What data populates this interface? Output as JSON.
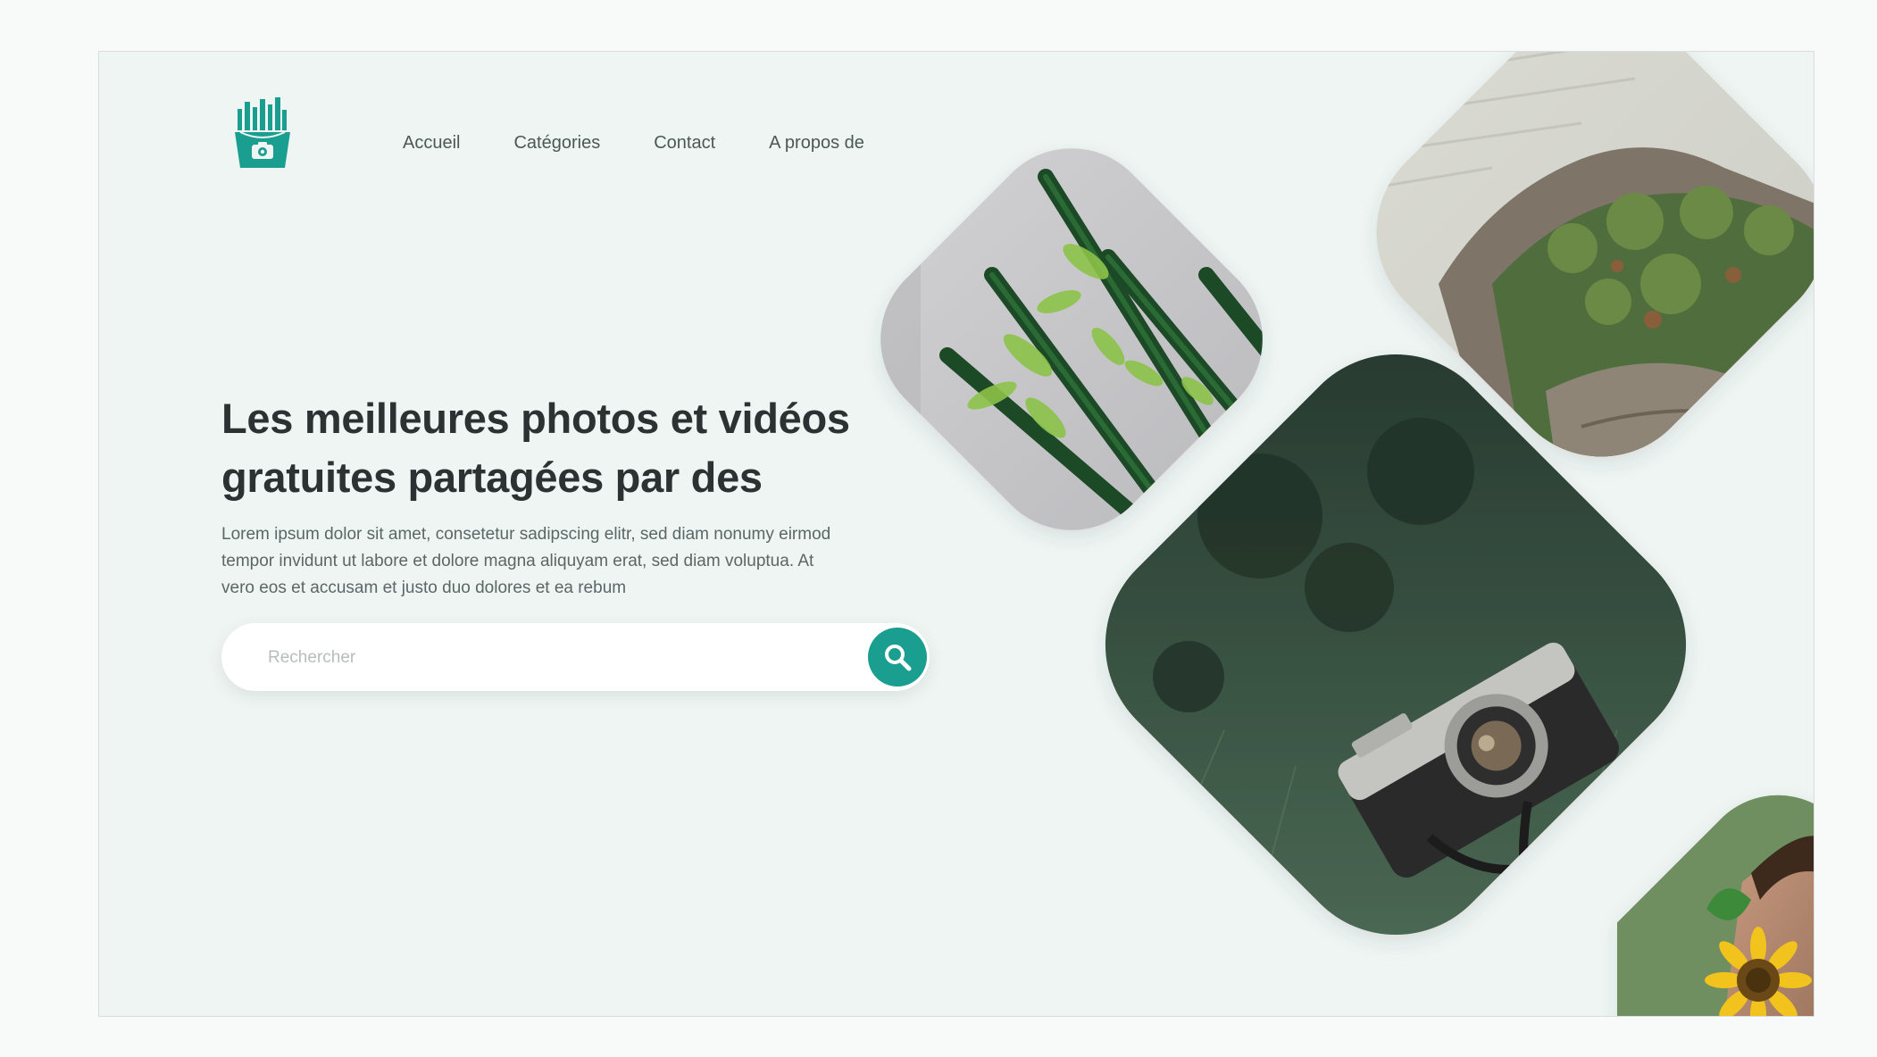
{
  "nav": {
    "items": [
      "Accueil",
      "Catégories",
      "Contact",
      "A propos de"
    ]
  },
  "hero": {
    "title": "Les meilleures photos et vidéos gratuites partagées par des",
    "description": "Lorem ipsum dolor sit amet, consetetur sadipscing elitr, sed diam nonumy eirmod tempor invidunt ut labore et dolore magna aliquyam erat, sed diam voluptua. At vero eos et accusam et justo duo dolores et ea rebum"
  },
  "search": {
    "placeholder": "Rechercher",
    "value": ""
  },
  "gallery": {
    "photos": [
      "cactus-photo",
      "rocky-coast-photo",
      "camera-photo",
      "sunflower-photo"
    ]
  },
  "colors": {
    "accent": "#1a9e8f",
    "background": "#eff5f3",
    "heading": "#2c3232",
    "body_text": "#5c6665"
  },
  "icons": {
    "logo": "fries-camera-logo-icon",
    "search": "search-icon"
  }
}
